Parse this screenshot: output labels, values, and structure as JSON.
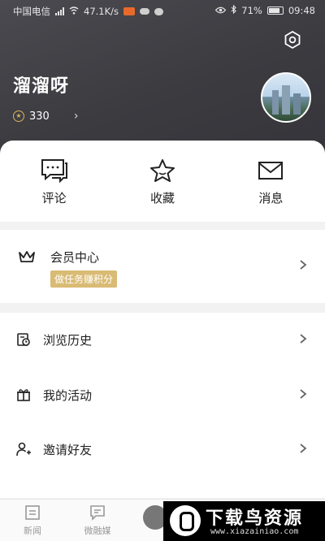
{
  "status_bar": {
    "carrier": "中国电信",
    "speed": "47.1K/s",
    "battery": "71%",
    "time": "09:48",
    "icons": [
      "signal-icon",
      "wifi-icon",
      "app-notification-icon",
      "cloud-icon",
      "chat-icon",
      "eye-icon",
      "bluetooth-icon",
      "battery-icon"
    ]
  },
  "profile": {
    "username": "溜溜呀",
    "points": "330",
    "avatar_icon": "city-photo-avatar"
  },
  "quick_actions": [
    {
      "label": "评论",
      "icon": "comment-icon"
    },
    {
      "label": "收藏",
      "icon": "star-icon"
    },
    {
      "label": "消息",
      "icon": "mail-icon"
    }
  ],
  "member": {
    "title": "会员中心",
    "badge": "做任务赚积分",
    "icon": "crown-icon"
  },
  "menu": [
    {
      "label": "浏览历史",
      "icon": "history-icon"
    },
    {
      "label": "我的活动",
      "icon": "gift-icon"
    },
    {
      "label": "邀请好友",
      "icon": "add-user-icon"
    }
  ],
  "tabs": [
    {
      "label": "新闻",
      "icon": "news-icon"
    },
    {
      "label": "微融媒",
      "icon": "media-icon"
    }
  ],
  "watermark": {
    "text": "下载鸟资源",
    "url": "www.xiazainiao.com"
  },
  "colors": {
    "header": "#3b3b40",
    "badge": "#d9bb74",
    "coin": "#d9b45c"
  }
}
